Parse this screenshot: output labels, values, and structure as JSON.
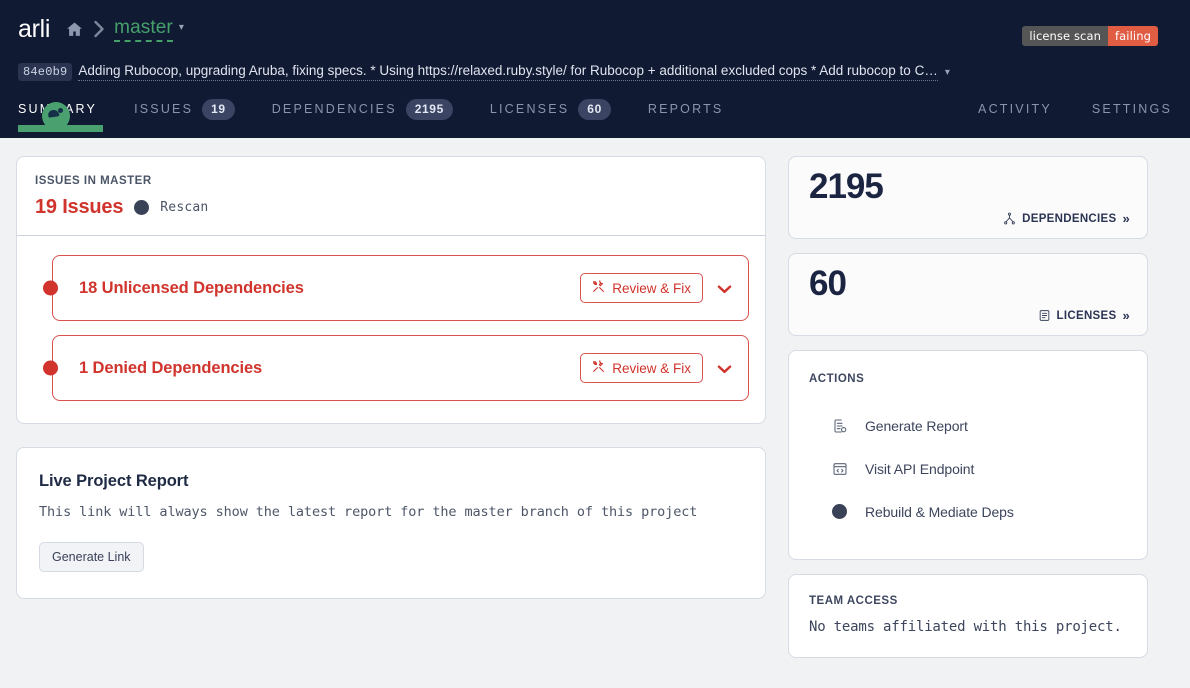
{
  "topbar": {
    "brand": "arli",
    "home_icon": "home-icon",
    "separator": "›",
    "branch": "master",
    "branch_caret": "▾",
    "badge": {
      "left": "license scan",
      "right": "failing"
    },
    "commit": {
      "sha": "84e0b9",
      "separator": ":",
      "message": "Adding Rubocop, upgrading Aruba, fixing specs. * Using https://relaxed.ruby.style/ for Rubocop + additional excluded cops * Add rubocop to C…",
      "caret": "▾"
    }
  },
  "tabs": {
    "left": [
      {
        "label": "SUMMARY",
        "count": null,
        "active": true
      },
      {
        "label": "ISSUES",
        "count": "19",
        "active": false
      },
      {
        "label": "DEPENDENCIES",
        "count": "2195",
        "active": false
      },
      {
        "label": "LICENSES",
        "count": "60",
        "active": false
      },
      {
        "label": "REPORTS",
        "count": null,
        "active": false
      }
    ],
    "right": [
      {
        "label": "ACTIVITY"
      },
      {
        "label": "SETTINGS"
      }
    ]
  },
  "issues_panel": {
    "kicker": "ISSUES IN MASTER",
    "count_label": "19 Issues",
    "rescan_label": "Rescan",
    "rows": [
      {
        "title": "18 Unlicensed Dependencies",
        "button": "Review & Fix",
        "chevron": "❯"
      },
      {
        "title": "1 Denied Dependencies",
        "button": "Review & Fix",
        "chevron": "❯"
      }
    ]
  },
  "report_panel": {
    "title": "Live Project Report",
    "description": "This link will always show the latest report for the master branch of this project",
    "button": "Generate Link"
  },
  "sidebar": {
    "stats": [
      {
        "value": "2195",
        "label": "DEPENDENCIES",
        "chevron": "»",
        "icon": "dependency-tree-icon"
      },
      {
        "value": "60",
        "label": "LICENSES",
        "chevron": "»",
        "icon": "license-clipboard-icon"
      }
    ],
    "actions": {
      "kicker": "ACTIONS",
      "items": [
        {
          "label": "Generate Report",
          "icon": "document-report-icon"
        },
        {
          "label": "Visit API Endpoint",
          "icon": "code-window-icon"
        },
        {
          "label": "Rebuild & Mediate Deps",
          "icon": "filled-circle-icon"
        }
      ]
    },
    "team": {
      "kicker": "TEAM ACCESS",
      "text": "No teams affiliated with this project."
    }
  },
  "colors": {
    "navy": "#111a33",
    "green": "#4aa06e",
    "red": "#d0342c",
    "badge_fail": "#e05d44",
    "page_bg": "#f1f2f4"
  }
}
